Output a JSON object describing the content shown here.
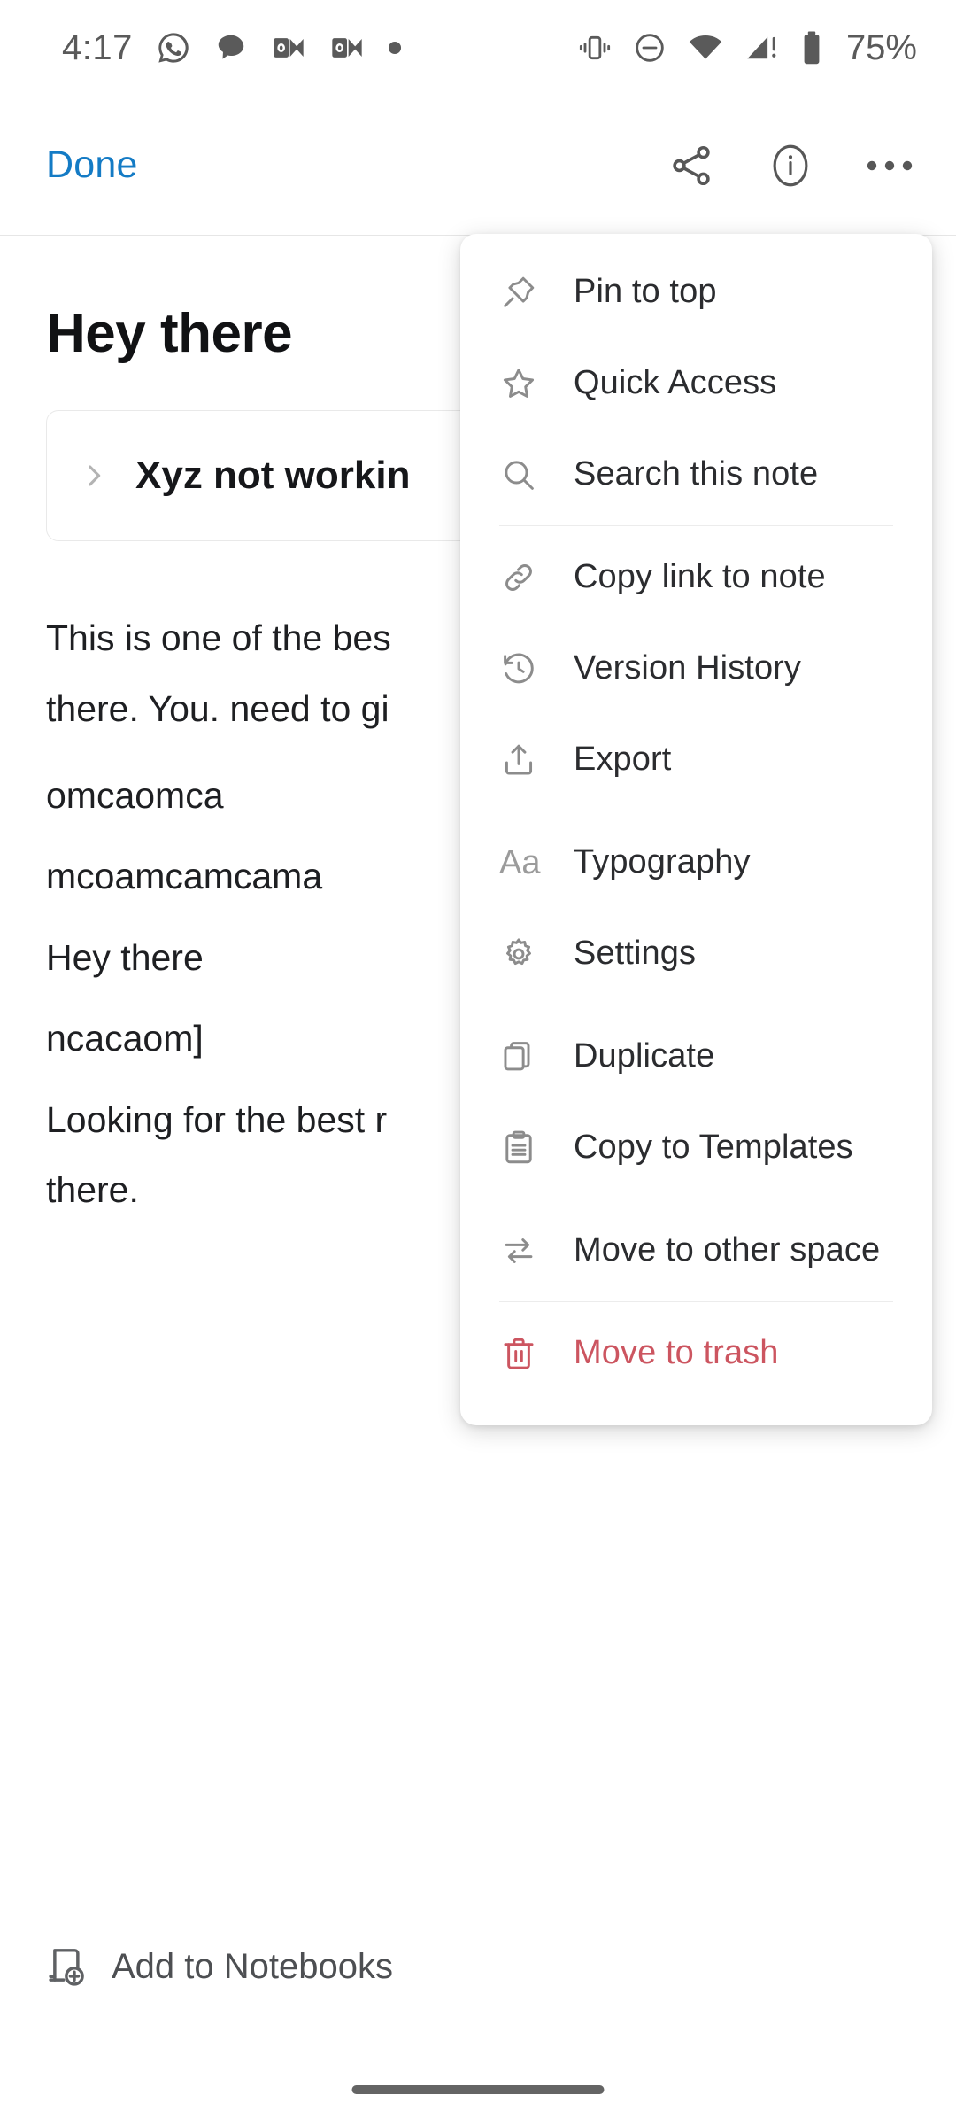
{
  "status_bar": {
    "time": "4:17",
    "battery_percent": "75%",
    "left_icons": [
      {
        "name": "whatsapp-icon"
      },
      {
        "name": "chat-bubble-icon"
      },
      {
        "name": "outlook-icon"
      },
      {
        "name": "outlook-icon-2"
      },
      {
        "name": "more-notifications-dot-icon"
      }
    ],
    "right_icons": [
      {
        "name": "vibrate-icon"
      },
      {
        "name": "do-not-disturb-icon"
      },
      {
        "name": "wifi-icon"
      },
      {
        "name": "cellular-signal-warning-icon"
      },
      {
        "name": "battery-icon"
      }
    ]
  },
  "toolbar": {
    "done_label": "Done",
    "share_icon": "share-icon",
    "info_icon": "info-circle-icon",
    "overflow_icon": "more-options-icon"
  },
  "note": {
    "title": "Hey there",
    "collapsible": {
      "chevron_icon": "chevron-right-icon",
      "title": "Xyz not workin"
    },
    "body_lines": [
      "This is one of the bes",
      "there. You. need to gi",
      "omcaomca",
      "mcoamcamcama",
      "Hey there",
      "ncacaom]",
      "Looking for the best r",
      "there."
    ]
  },
  "menu": {
    "groups": [
      {
        "items": [
          {
            "label": "Pin to top",
            "icon": "pin-icon",
            "danger": false
          },
          {
            "label": "Quick Access",
            "icon": "star-icon",
            "danger": false
          },
          {
            "label": "Search this note",
            "icon": "search-icon",
            "danger": false
          }
        ]
      },
      {
        "items": [
          {
            "label": "Copy link to note",
            "icon": "link-icon",
            "danger": false
          },
          {
            "label": "Version History",
            "icon": "history-clock-icon",
            "danger": false
          },
          {
            "label": "Export",
            "icon": "export-upload-icon",
            "danger": false
          }
        ]
      },
      {
        "items": [
          {
            "label": "Typography",
            "icon": "typography-aa-icon",
            "danger": false
          },
          {
            "label": "Settings",
            "icon": "gear-icon",
            "danger": false
          }
        ]
      },
      {
        "items": [
          {
            "label": "Duplicate",
            "icon": "duplicate-pages-icon",
            "danger": false
          },
          {
            "label": "Copy to Templates",
            "icon": "clipboard-icon",
            "danger": false
          }
        ]
      },
      {
        "items": [
          {
            "label": "Move to other space",
            "icon": "swap-arrows-icon",
            "danger": false
          }
        ]
      },
      {
        "items": [
          {
            "label": "Move to trash",
            "icon": "trash-icon",
            "danger": true
          }
        ]
      }
    ]
  },
  "bottom_bar": {
    "add_to_notebooks_label": "Add to Notebooks",
    "add_to_notebooks_icon": "notebook-add-icon"
  },
  "colors": {
    "accent_blue": "#147bc5",
    "danger_red": "#cc5560",
    "icon_gray": "#8c8c8c",
    "text_primary": "#1e1f22",
    "background": "#ffffff"
  }
}
